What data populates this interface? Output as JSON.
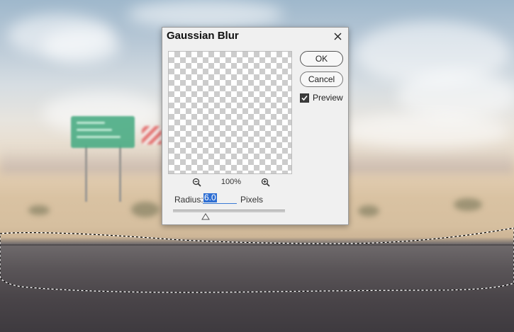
{
  "dialog": {
    "title": "Gaussian Blur",
    "ok_label": "OK",
    "cancel_label": "Cancel",
    "preview_label": "Preview",
    "preview_checked": true,
    "zoom_level": "100%",
    "radius_label": "Radius:",
    "radius_value": "6.0",
    "radius_unit": "Pixels",
    "slider_fraction": 0.29
  },
  "icons": [
    "close-icon",
    "zoom-out-icon",
    "zoom-in-icon",
    "checkmark-icon",
    "slider-thumb-icon"
  ],
  "colors": {
    "selection_accent": "#2f6fd3",
    "checkbox_fill": "#3b3b3b",
    "dialog_bg": "#f0f0f0"
  }
}
